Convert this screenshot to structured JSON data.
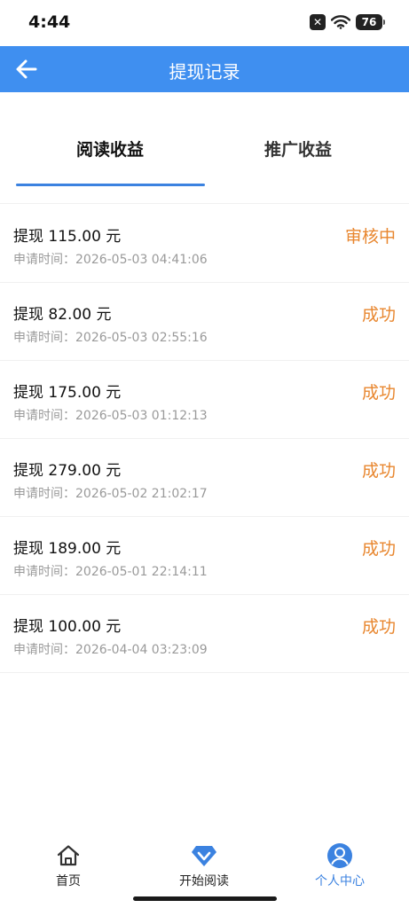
{
  "status_bar": {
    "time": "4:44",
    "battery": "76"
  },
  "header": {
    "title": "提现记录"
  },
  "tabs": [
    {
      "label": "阅读收益",
      "active": true
    },
    {
      "label": "推广收益",
      "active": false
    }
  ],
  "records": [
    {
      "amount": "提现 115.00 元",
      "time": "申请时间：2026-05-03 04:41:06",
      "status": "审核中"
    },
    {
      "amount": "提现 82.00 元",
      "time": "申请时间：2026-05-03 02:55:16",
      "status": "成功"
    },
    {
      "amount": "提现 175.00 元",
      "time": "申请时间：2026-05-03 01:12:13",
      "status": "成功"
    },
    {
      "amount": "提现 279.00 元",
      "time": "申请时间：2026-05-02 21:02:17",
      "status": "成功"
    },
    {
      "amount": "提现 189.00 元",
      "time": "申请时间：2026-05-01 22:14:11",
      "status": "成功"
    },
    {
      "amount": "提现 100.00 元",
      "time": "申请时间：2026-04-04 03:23:09",
      "status": "成功"
    }
  ],
  "bottom_nav": [
    {
      "label": "首页",
      "icon": "home-icon",
      "active": false
    },
    {
      "label": "开始阅读",
      "icon": "diamond-icon",
      "active": false
    },
    {
      "label": "个人中心",
      "icon": "user-icon",
      "active": true
    }
  ],
  "colors": {
    "header_bg": "#3f8ff0",
    "accent": "#3b82e0",
    "status_orange": "#e8862e"
  }
}
